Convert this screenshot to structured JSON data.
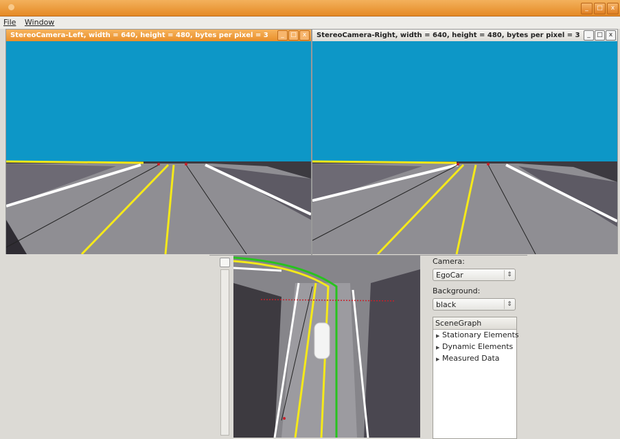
{
  "menubar": {
    "file": "File",
    "window": "Window"
  },
  "window_controls": {
    "minimize": "_",
    "maximize": "□",
    "close": "x"
  },
  "camera_left": {
    "title": "StereoCamera-Left, width = 640, height = 480, bytes per pixel = 3"
  },
  "camera_right": {
    "title": "StereoCamera-Right, width = 640, height = 480, bytes per pixel = 3"
  },
  "panel": {
    "camera_label": "Camera:",
    "camera_value": "EgoCar",
    "background_label": "Background:",
    "background_value": "black",
    "scenegraph": {
      "header": "SceneGraph",
      "items": [
        {
          "label": "Stationary Elements"
        },
        {
          "label": "Dynamic Elements"
        },
        {
          "label": "Measured Data"
        }
      ]
    }
  },
  "colors": {
    "sky": "#0d97c7",
    "road": "#9a9a9a",
    "lane_white": "#ffffff",
    "lane_yellow": "#f5e91a",
    "lane_green": "#27c31e",
    "window_accent": "#e58a25"
  },
  "icons": {
    "expander": "triangle-right-icon",
    "combo_arrows": "up-down-arrows-icon"
  }
}
